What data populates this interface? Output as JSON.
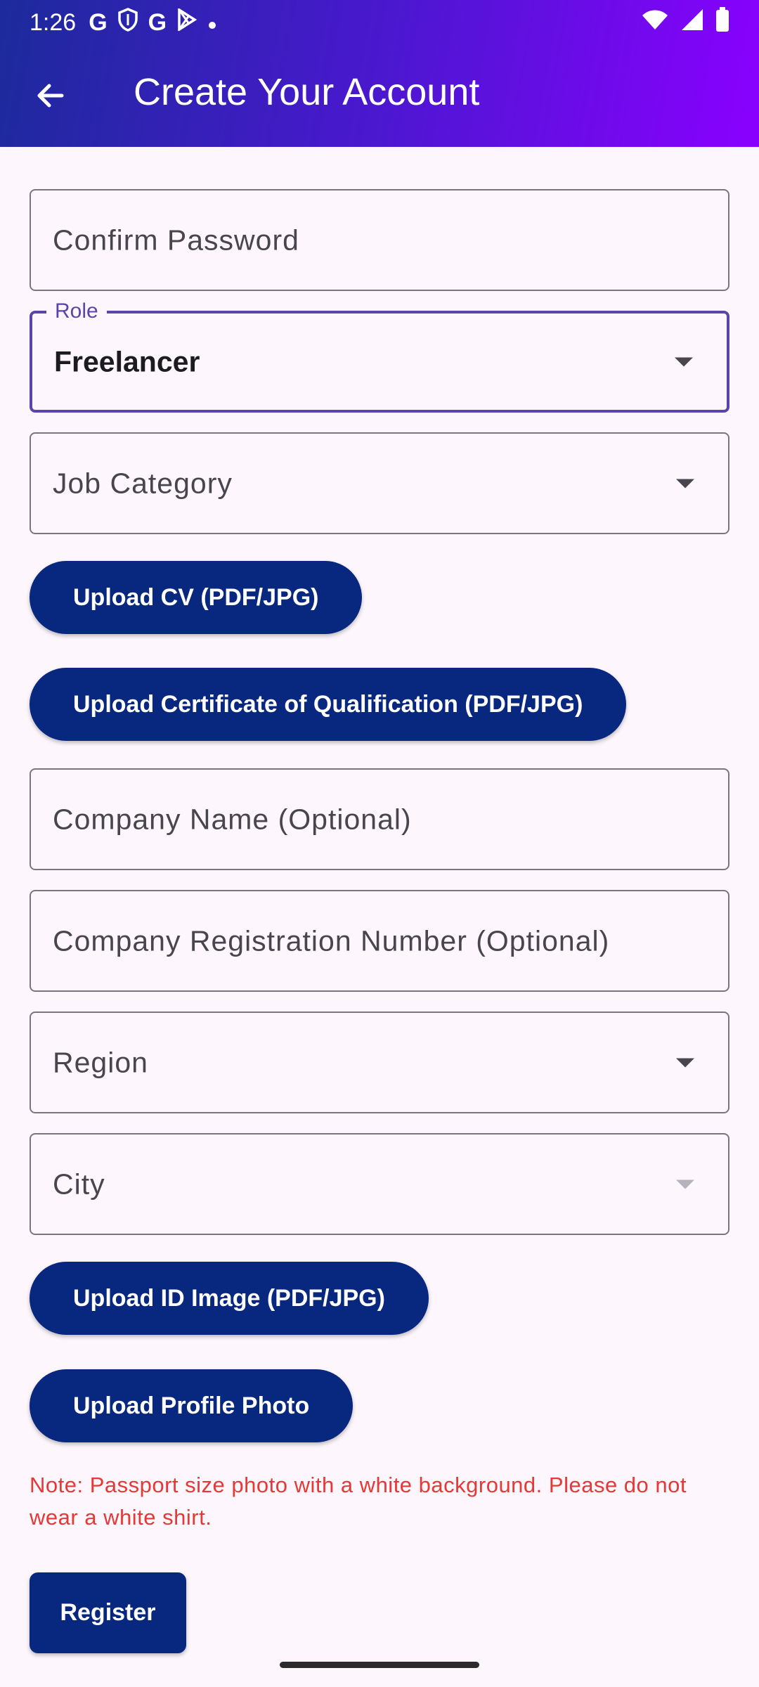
{
  "status_bar": {
    "time": "1:26",
    "icons": [
      "google-icon",
      "shield-icon",
      "google-icon",
      "play-store-icon",
      "dot-icon"
    ],
    "right_icons": [
      "wifi-icon",
      "signal-icon",
      "battery-icon"
    ]
  },
  "app_bar": {
    "title": "Create Your Account",
    "back_icon": "arrow-back-icon",
    "gradient_colors": [
      "#1c2a9c",
      "#4a18cf",
      "#8a00ff"
    ]
  },
  "form": {
    "confirm_password": {
      "placeholder": "Confirm Password"
    },
    "role": {
      "label": "Role",
      "value": "Freelancer"
    },
    "job_category": {
      "placeholder": "Job Category"
    },
    "upload_cv": "Upload CV (PDF/JPG)",
    "upload_certificate": "Upload Certificate of Qualification (PDF/JPG)",
    "company_name": {
      "placeholder": "Company Name (Optional)"
    },
    "company_reg": {
      "placeholder": "Company Registration Number (Optional)"
    },
    "region": {
      "placeholder": "Region"
    },
    "city": {
      "placeholder": "City"
    },
    "upload_id": "Upload ID Image (PDF/JPG)",
    "upload_photo": "Upload Profile Photo",
    "note": "Note: Passport size photo with a white background. Please do not wear a white shirt.",
    "register": "Register"
  },
  "colors": {
    "primary_button": "#08287f",
    "focus_outline": "#5a45a8",
    "error_text": "#e53935",
    "background": "#fdf7fd"
  }
}
